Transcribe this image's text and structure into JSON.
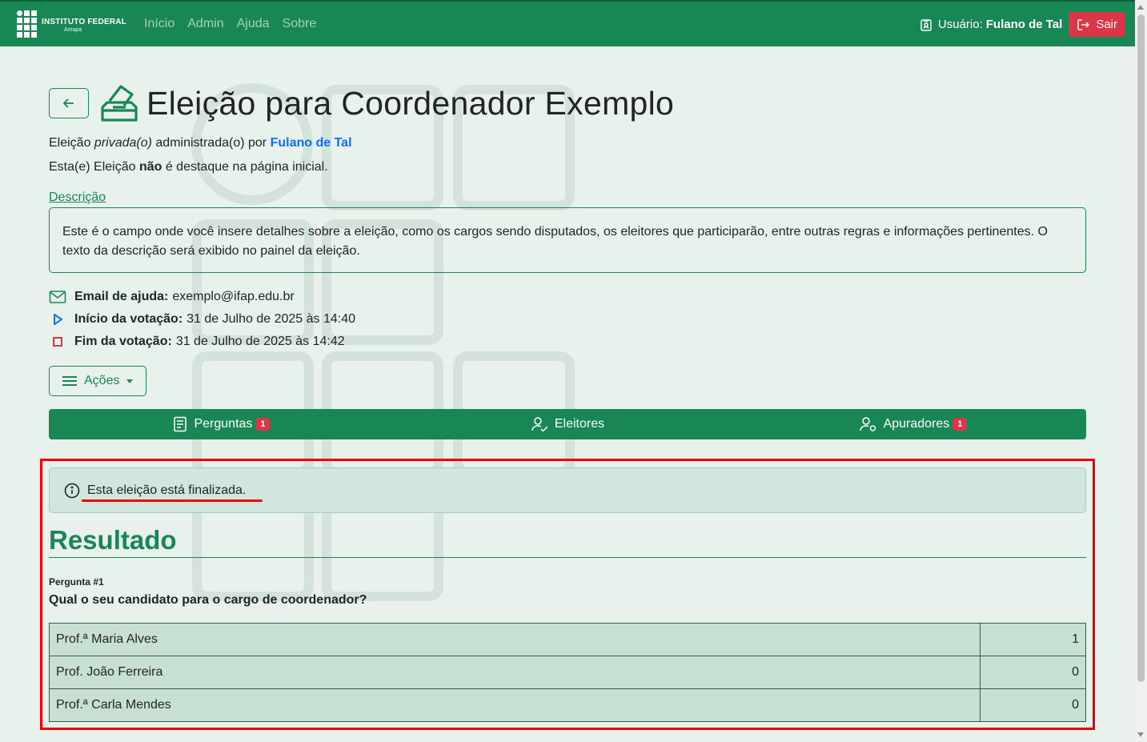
{
  "navbar": {
    "brand_line1": "INSTITUTO FEDERAL",
    "brand_line2": "Amapá",
    "links": [
      "Início",
      "Admin",
      "Ajuda",
      "Sobre"
    ],
    "user_label": "Usuário:",
    "user_name": "Fulano de Tal",
    "logout_label": "Sair"
  },
  "page": {
    "title": "Eleição para Coordenador Exemplo",
    "meta_prefix": "Eleição ",
    "meta_private": "privada(o)",
    "meta_mid": " administrada(o) por ",
    "meta_admin": "Fulano de Tal",
    "highlight_prefix": "Esta(e) Eleição ",
    "highlight_bold": "não",
    "highlight_suffix": " é destaque na página inicial.",
    "description_label": "Descrição",
    "description": "Este é o campo onde você insere detalhes sobre a eleição, como os cargos sendo disputados, os eleitores que participarão, entre outras regras e informações pertinentes. O texto da descrição será exibido no painel da eleição.",
    "help_email_label": "Email de ajuda:",
    "help_email": "exemplo@ifap.edu.br",
    "start_label": "Início da votação:",
    "start_value": "31 de Julho de 2025 às 14:40",
    "end_label": "Fim da votação:",
    "end_value": "31 de Julho de 2025 às 14:42",
    "actions_label": "Ações"
  },
  "tabs": [
    {
      "label": "Perguntas",
      "badge": "1"
    },
    {
      "label": "Eleitores"
    },
    {
      "label": "Apuradores",
      "badge": "1"
    }
  ],
  "result": {
    "alert": "Esta eleição está finalizada.",
    "title": "Resultado",
    "question_number": "Pergunta #1",
    "question": "Qual o seu candidato para o cargo de coordenador?",
    "rows": [
      {
        "candidate": "Prof.ª Maria Alves",
        "votes": "1"
      },
      {
        "candidate": "Prof. João Ferreira",
        "votes": "0"
      },
      {
        "candidate": "Prof.ª Carla Mendes",
        "votes": "0"
      }
    ]
  },
  "colors": {
    "primary": "#198754",
    "danger": "#dc3545",
    "link": "#0d6efd",
    "background": "#e8f1ec"
  }
}
